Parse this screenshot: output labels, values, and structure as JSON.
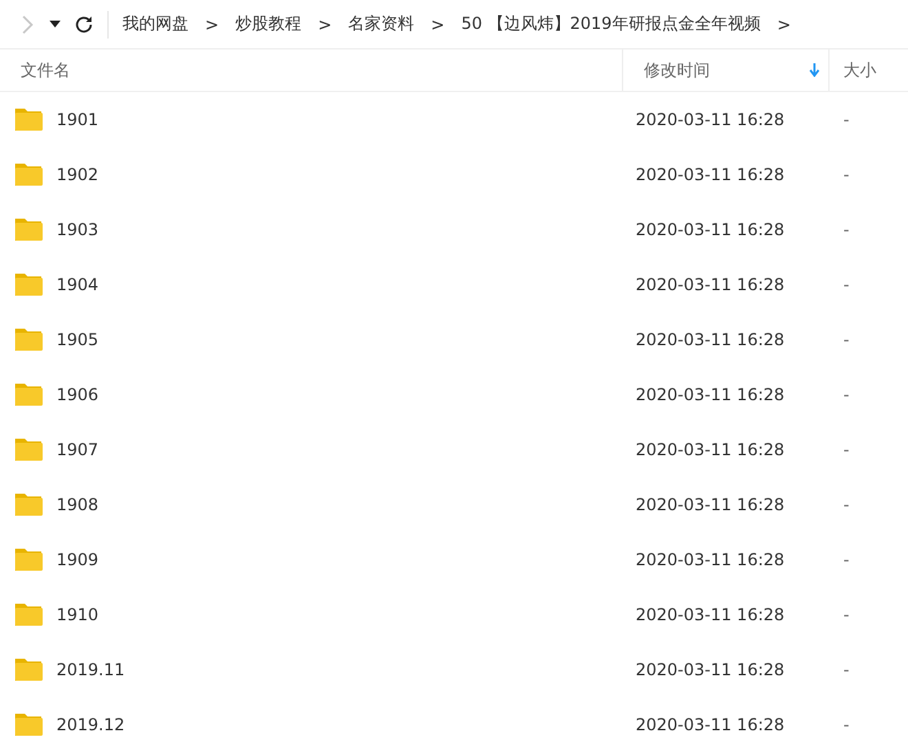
{
  "toolbar": {
    "forward_disabled": true
  },
  "breadcrumb": [
    {
      "label": "我的网盘",
      "separator": ">"
    },
    {
      "label": "炒股教程",
      "separator": ">"
    },
    {
      "label": "名家资料",
      "separator": ">"
    },
    {
      "label": "50 【边风炜】2019年研报点金全年视频",
      "separator": ">"
    }
  ],
  "table": {
    "columns": [
      {
        "label": "文件名",
        "sorted": false
      },
      {
        "label": "修改时间",
        "sorted": true
      },
      {
        "label": "大小",
        "sorted": false
      }
    ],
    "rows": [
      {
        "name": "1901",
        "modified": "2020-03-11 16:28",
        "size": "-"
      },
      {
        "name": "1902",
        "modified": "2020-03-11 16:28",
        "size": "-"
      },
      {
        "name": "1903",
        "modified": "2020-03-11 16:28",
        "size": "-"
      },
      {
        "name": "1904",
        "modified": "2020-03-11 16:28",
        "size": "-"
      },
      {
        "name": "1905",
        "modified": "2020-03-11 16:28",
        "size": "-"
      },
      {
        "name": "1906",
        "modified": "2020-03-11 16:28",
        "size": "-"
      },
      {
        "name": "1907",
        "modified": "2020-03-11 16:28",
        "size": "-"
      },
      {
        "name": "1908",
        "modified": "2020-03-11 16:28",
        "size": "-"
      },
      {
        "name": "1909",
        "modified": "2020-03-11 16:28",
        "size": "-"
      },
      {
        "name": "1910",
        "modified": "2020-03-11 16:28",
        "size": "-"
      },
      {
        "name": "2019.11",
        "modified": "2020-03-11 16:28",
        "size": "-"
      },
      {
        "name": "2019.12",
        "modified": "2020-03-11 16:28",
        "size": "-"
      }
    ]
  }
}
